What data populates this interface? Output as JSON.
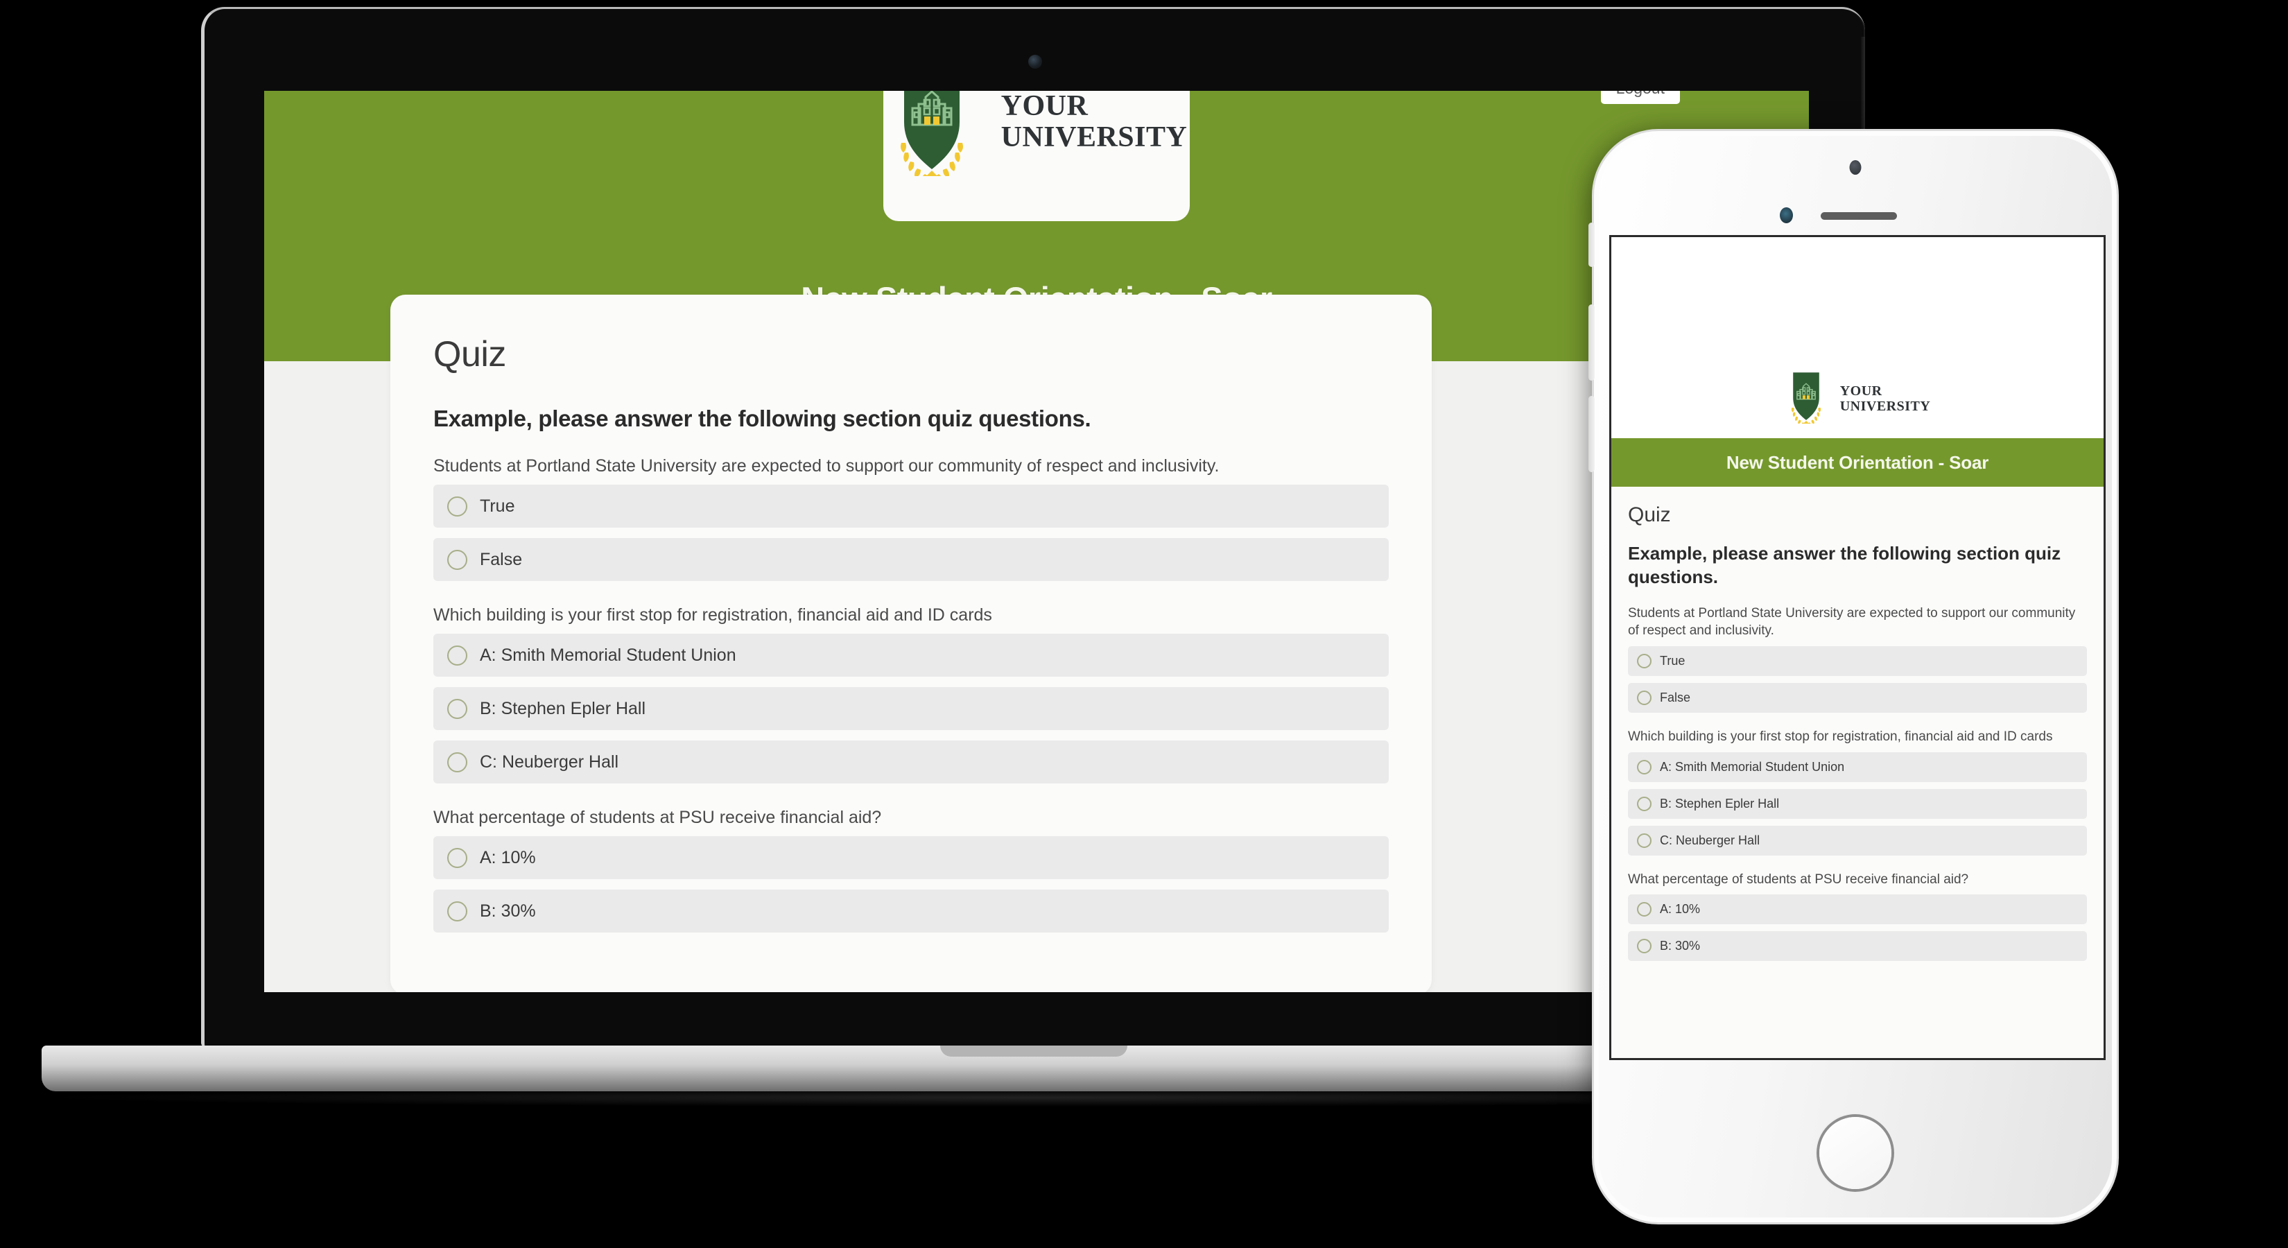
{
  "brand": {
    "logo_line1": "YOUR",
    "logo_line2": "UNIVERSITY",
    "green": "#75982d",
    "shield_green": "#2e5d33",
    "gold": "#f2c832"
  },
  "laptop": {
    "course_title": "New Student Orientation - Soar",
    "logout_label": "Logout",
    "quiz": {
      "heading": "Quiz",
      "instructions": "Example, please answer the following section quiz questions.",
      "questions": [
        {
          "prompt": "Students at Portland State University are expected to support our community of respect and inclusivity.",
          "options": [
            "True",
            "False"
          ]
        },
        {
          "prompt": "Which building is your first stop for registration, financial aid and ID cards",
          "options": [
            "A: Smith Memorial Student Union",
            "B: Stephen Epler Hall",
            "C: Neuberger Hall"
          ]
        },
        {
          "prompt": "What percentage of students at PSU receive financial aid?",
          "options": [
            "A: 10%",
            "B: 30%"
          ]
        }
      ]
    }
  },
  "phone": {
    "course_title": "New Student Orientation - Soar",
    "quiz": {
      "heading": "Quiz",
      "instructions": "Example, please answer the following section quiz questions.",
      "questions": [
        {
          "prompt": "Students at Portland State University are expected to support our community of respect and inclusivity.",
          "options": [
            "True",
            "False"
          ]
        },
        {
          "prompt": "Which building is your first stop for registration, financial aid and ID cards",
          "options": [
            "A: Smith Memorial Student Union",
            "B: Stephen Epler Hall",
            "C: Neuberger Hall"
          ]
        },
        {
          "prompt": "What percentage of students at PSU receive financial aid?",
          "options": [
            "A: 10%",
            "B: 30%"
          ]
        }
      ]
    }
  }
}
